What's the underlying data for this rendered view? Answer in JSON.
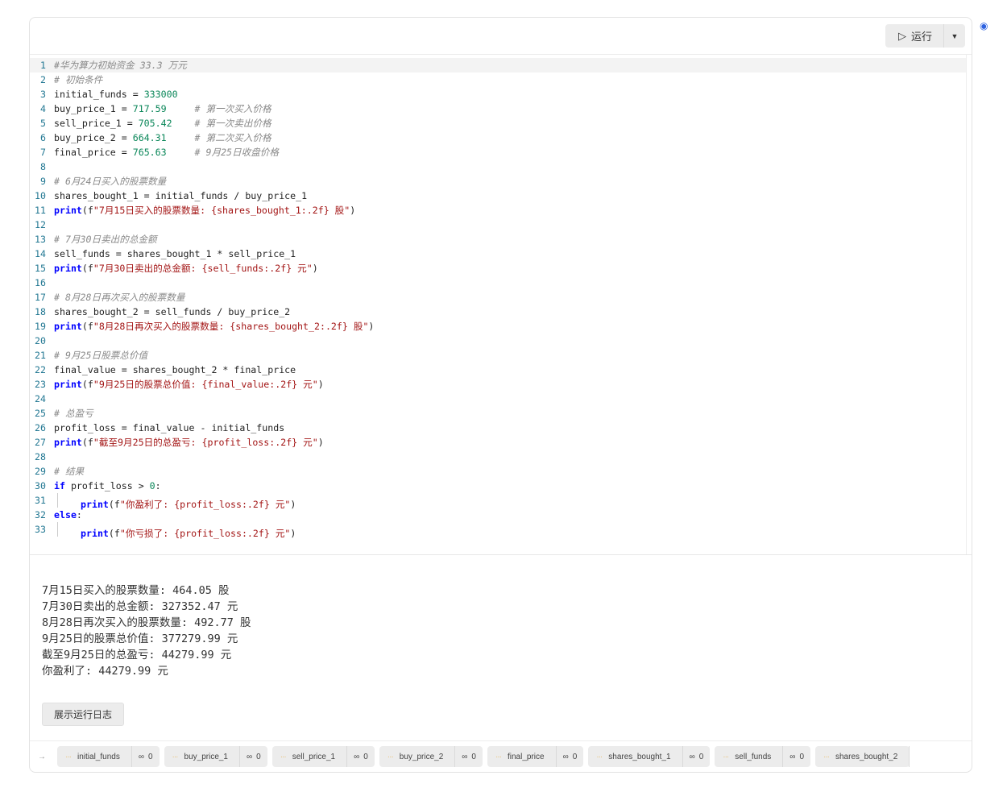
{
  "toolbar": {
    "run_label": "运行",
    "run_icon": "play-icon",
    "dropdown_icon": "caret-down-icon"
  },
  "code": [
    [
      [
        "c",
        "#华为算力初始资金 33.3 万元"
      ]
    ],
    [
      [
        "c",
        "# 初始条件"
      ]
    ],
    [
      [
        "p",
        "initial_funds = "
      ],
      [
        "n",
        "333000"
      ]
    ],
    [
      [
        "p",
        "buy_price_1 = "
      ],
      [
        "n",
        "717.59"
      ],
      [
        "p",
        "     "
      ],
      [
        "c",
        "# 第一次买入价格"
      ]
    ],
    [
      [
        "p",
        "sell_price_1 = "
      ],
      [
        "n",
        "705.42"
      ],
      [
        "p",
        "    "
      ],
      [
        "c",
        "# 第一次卖出价格"
      ]
    ],
    [
      [
        "p",
        "buy_price_2 = "
      ],
      [
        "n",
        "664.31"
      ],
      [
        "p",
        "     "
      ],
      [
        "c",
        "# 第二次买入价格"
      ]
    ],
    [
      [
        "p",
        "final_price = "
      ],
      [
        "n",
        "765.63"
      ],
      [
        "p",
        "     "
      ],
      [
        "c",
        "# 9月25日收盘价格"
      ]
    ],
    [],
    [
      [
        "c",
        "# 6月24日买入的股票数量"
      ]
    ],
    [
      [
        "p",
        "shares_bought_1 = initial_funds / buy_price_1"
      ]
    ],
    [
      [
        "k",
        "print"
      ],
      [
        "p",
        "(f"
      ],
      [
        "s",
        "\"7月15日买入的股票数量: {shares_bought_1:.2f} 股\""
      ],
      [
        "p",
        ")"
      ]
    ],
    [],
    [
      [
        "c",
        "# 7月30日卖出的总金额"
      ]
    ],
    [
      [
        "p",
        "sell_funds = shares_bought_1 * sell_price_1"
      ]
    ],
    [
      [
        "k",
        "print"
      ],
      [
        "p",
        "(f"
      ],
      [
        "s",
        "\"7月30日卖出的总金额: {sell_funds:.2f} 元\""
      ],
      [
        "p",
        ")"
      ]
    ],
    [],
    [
      [
        "c",
        "# 8月28日再次买入的股票数量"
      ]
    ],
    [
      [
        "p",
        "shares_bought_2 = sell_funds / buy_price_2"
      ]
    ],
    [
      [
        "k",
        "print"
      ],
      [
        "p",
        "(f"
      ],
      [
        "s",
        "\"8月28日再次买入的股票数量: {shares_bought_2:.2f} 股\""
      ],
      [
        "p",
        ")"
      ]
    ],
    [],
    [
      [
        "c",
        "# 9月25日股票总价值"
      ]
    ],
    [
      [
        "p",
        "final_value = shares_bought_2 * final_price"
      ]
    ],
    [
      [
        "k",
        "print"
      ],
      [
        "p",
        "(f"
      ],
      [
        "s",
        "\"9月25日的股票总价值: {final_value:.2f} 元\""
      ],
      [
        "p",
        ")"
      ]
    ],
    [],
    [
      [
        "c",
        "# 总盈亏"
      ]
    ],
    [
      [
        "p",
        "profit_loss = final_value - initial_funds"
      ]
    ],
    [
      [
        "k",
        "print"
      ],
      [
        "p",
        "(f"
      ],
      [
        "s",
        "\"截至9月25日的总盈亏: {profit_loss:.2f} 元\""
      ],
      [
        "p",
        ")"
      ]
    ],
    [],
    [
      [
        "c",
        "# 结果"
      ]
    ],
    [
      [
        "k",
        "if"
      ],
      [
        "p",
        " profit_loss > "
      ],
      [
        "n",
        "0"
      ],
      [
        "p",
        ":"
      ]
    ],
    [
      [
        "i",
        ""
      ],
      [
        "k",
        "print"
      ],
      [
        "p",
        "(f"
      ],
      [
        "s",
        "\"你盈利了: {profit_loss:.2f} 元\""
      ],
      [
        "p",
        ")"
      ]
    ],
    [
      [
        "k",
        "else"
      ],
      [
        "p",
        ":"
      ]
    ],
    [
      [
        "i",
        ""
      ],
      [
        "k",
        "print"
      ],
      [
        "p",
        "(f"
      ],
      [
        "s",
        "\"你亏损了: {profit_loss:.2f} 元\""
      ],
      [
        "p",
        ")"
      ]
    ]
  ],
  "output": [
    "7月15日买入的股票数量: 464.05 股",
    "7月30日卖出的总金额: 327352.47 元",
    "8月28日再次买入的股票数量: 492.77 股",
    "9月25日的股票总价值: 377279.99 元",
    "截至9月25日的总盈亏: 44279.99 元",
    "你盈利了: 44279.99 元"
  ],
  "log_button": "展示运行日志",
  "variables": [
    {
      "name": "initial_funds",
      "refs": "0"
    },
    {
      "name": "buy_price_1",
      "refs": "0"
    },
    {
      "name": "sell_price_1",
      "refs": "0"
    },
    {
      "name": "buy_price_2",
      "refs": "0"
    },
    {
      "name": "final_price",
      "refs": "0"
    },
    {
      "name": "shares_bought_1",
      "refs": "0"
    },
    {
      "name": "sell_funds",
      "refs": "0"
    },
    {
      "name": "shares_bought_2",
      "refs": ""
    }
  ]
}
